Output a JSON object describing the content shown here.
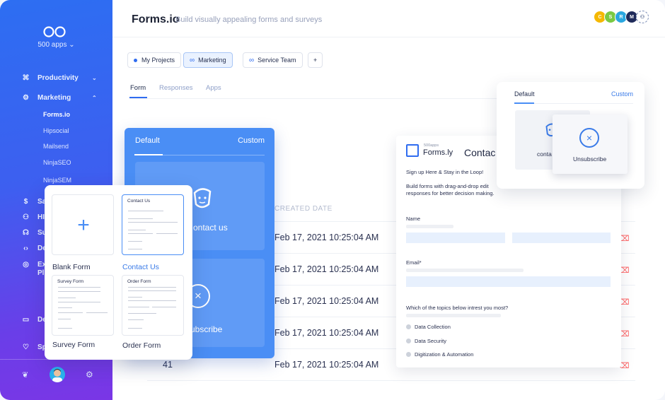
{
  "sidebar": {
    "apps_count": "500 apps",
    "items": [
      {
        "label": "Productivity",
        "icon": "command-icon"
      },
      {
        "label": "Marketing",
        "icon": "gear-icon"
      }
    ],
    "sub_items": [
      "Forms.io",
      "Hipsocial",
      "Mailsend",
      "NinjaSEO",
      "NinjaSEM"
    ],
    "partial_items": [
      "Sa",
      "HI",
      "Su",
      "De",
      "Ex",
      "Pl",
      "De",
      "Sp"
    ]
  },
  "header": {
    "title": "Forms.io",
    "subtitle": "Build visually appealing forms and surveys",
    "users": [
      {
        "initial": "C",
        "color": "#f5b800"
      },
      {
        "initial": "S",
        "color": "#7ac943"
      },
      {
        "initial": "R",
        "color": "#2aa7e0"
      },
      {
        "initial": "M",
        "color": "#1f2a5a"
      }
    ]
  },
  "project_tabs": [
    "My Projects",
    "Marketing",
    "Service Team",
    "+"
  ],
  "content_tabs": [
    "Form",
    "Responses",
    "Apps"
  ],
  "table": {
    "date_header": "CREATED DATE",
    "dates": [
      "Feb 17, 2021 10:25:04 AM",
      "Feb 17, 2021 10:25:04 AM",
      "Feb 17, 2021 10:25:04 AM",
      "Feb 17, 2021 10:25:04 AM",
      "Feb 17, 2021 10:25:04 AM"
    ],
    "last_row_number": "41"
  },
  "blue_card": {
    "tab_default": "Default",
    "tab_custom": "Custom",
    "option1": "ontact us",
    "option2": "ubscribe"
  },
  "templates": {
    "blank": "Blank Form",
    "contact": "Contact Us",
    "contact_head": "Contact Us",
    "survey": "Survey Form",
    "survey_head": "Survey Form",
    "order": "Order Form",
    "order_head": "Order Form"
  },
  "form_preview": {
    "brand_small": "500apps",
    "brand": "Forms.ly",
    "title": "Contac",
    "intro": "Sign up Here & Stay in the Loop!",
    "desc1": "Build forms with drag-and-drop edit",
    "desc2": "responses for better decision making.",
    "name_label": "Name",
    "email_label": "Email*",
    "topics_label": "Which of the topics below intrest you most?",
    "topics": [
      "Data Collection",
      "Data Security",
      "Digitization & Automation"
    ]
  },
  "popup": {
    "tab_default": "Default",
    "tab_custom": "Custom",
    "option1": "conta",
    "option2": "Unsubscribe"
  }
}
